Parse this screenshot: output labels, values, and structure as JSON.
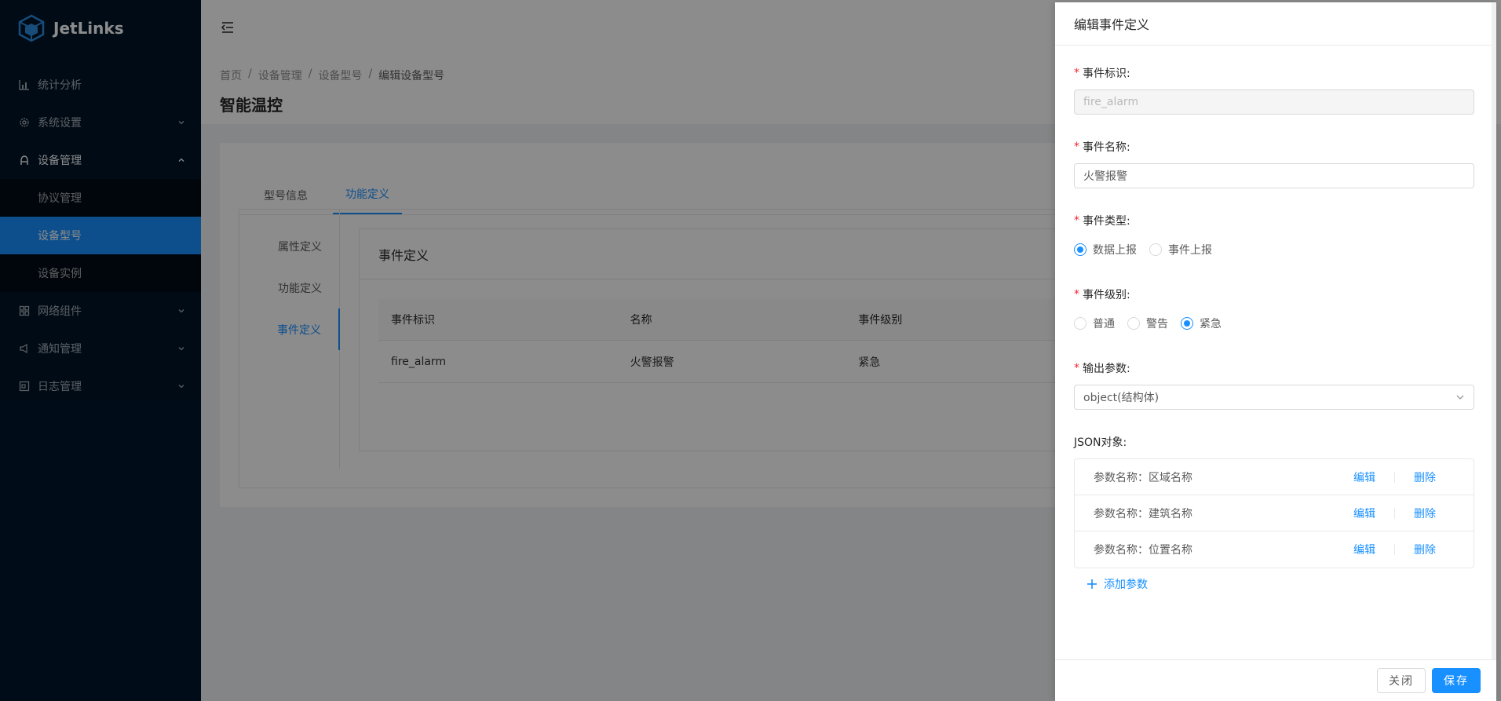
{
  "app": {
    "name": "JetLinks"
  },
  "sidebar": {
    "items": [
      {
        "label": "统计分析",
        "icon": "bar-chart-icon"
      },
      {
        "label": "系统设置",
        "icon": "gear-icon"
      },
      {
        "label": "设备管理",
        "icon": "user-icon"
      },
      {
        "label": "网络组件",
        "icon": "grid-icon"
      },
      {
        "label": "通知管理",
        "icon": "sound-icon"
      },
      {
        "label": "日志管理",
        "icon": "log-icon"
      }
    ],
    "device_sub": [
      "协议管理",
      "设备型号",
      "设备实例"
    ]
  },
  "breadcrumb": [
    "首页",
    "设备管理",
    "设备型号",
    "编辑设备型号"
  ],
  "page": {
    "title": "智能温控"
  },
  "tabs": [
    "型号信息",
    "功能定义"
  ],
  "vtabs": [
    "属性定义",
    "功能定义",
    "事件定义"
  ],
  "event_card": {
    "title": "事件定义",
    "headers": [
      "事件标识",
      "名称",
      "事件级别"
    ],
    "rows": [
      [
        "fire_alarm",
        "火警报警",
        "紧急"
      ]
    ]
  },
  "drawer": {
    "title": "编辑事件定义",
    "id_label": "事件标识:",
    "id_value": "fire_alarm",
    "name_label": "事件名称:",
    "name_value": "火警报警",
    "type_label": "事件类型:",
    "type_options": [
      "数据上报",
      "事件上报"
    ],
    "type_selected": "数据上报",
    "level_label": "事件级别:",
    "level_options": [
      "普通",
      "警告",
      "紧急"
    ],
    "level_selected": "紧急",
    "output_label": "输出参数:",
    "output_value": "object(结构体)",
    "json_label": "JSON对象:",
    "params": [
      "参数名称：区域名称",
      "参数名称：建筑名称",
      "参数名称：位置名称"
    ],
    "edit_label": "编辑",
    "delete_label": "删除",
    "add_label": "添加参数",
    "close_label": "关闭",
    "save_label": "保存"
  },
  "colors": {
    "primary": "#1890ff",
    "sider": "#001529",
    "required": "#f5222d"
  }
}
